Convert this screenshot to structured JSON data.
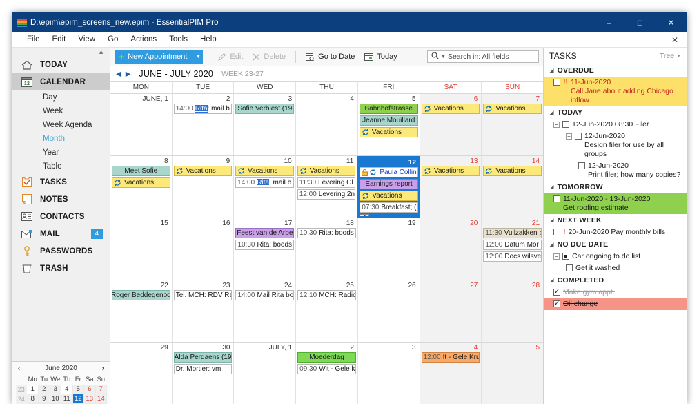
{
  "window": {
    "title": "D:\\epim\\epim_screens_new.epim - EssentialPIM Pro",
    "app_icon": "epim-logo-icon",
    "minimize": "–",
    "maximize": "□",
    "close": "✕"
  },
  "menu": {
    "items": [
      "File",
      "Edit",
      "View",
      "Go",
      "Actions",
      "Tools",
      "Help"
    ],
    "close_doc": "✕"
  },
  "sidebar": {
    "items": [
      {
        "label": "TODAY",
        "icon": "home-icon",
        "selected": false
      },
      {
        "label": "CALENDAR",
        "icon": "calendar-icon",
        "selected": true
      },
      {
        "label": "TASKS",
        "icon": "clipboard-check-icon",
        "selected": false
      },
      {
        "label": "NOTES",
        "icon": "note-icon",
        "selected": false
      },
      {
        "label": "CONTACTS",
        "icon": "contact-card-icon",
        "selected": false
      },
      {
        "label": "MAIL",
        "icon": "envelope-icon",
        "selected": false,
        "badge": "4"
      },
      {
        "label": "PASSWORDS",
        "icon": "key-icon",
        "selected": false
      },
      {
        "label": "TRASH",
        "icon": "trash-icon",
        "selected": false
      }
    ],
    "calendar_subitems": [
      {
        "label": "Day",
        "active": false
      },
      {
        "label": "Week",
        "active": false
      },
      {
        "label": "Week Agenda",
        "active": false
      },
      {
        "label": "Month",
        "active": true
      },
      {
        "label": "Year",
        "active": false
      },
      {
        "label": "Table",
        "active": false
      }
    ]
  },
  "minicalendar": {
    "prev": "‹",
    "next": "›",
    "title": "June 2020",
    "weekday_headers": [
      "Mo",
      "Tu",
      "We",
      "Th",
      "Fr",
      "Sa",
      "Su"
    ],
    "rows": [
      {
        "week": "23",
        "days": [
          "1",
          "2",
          "3",
          "4",
          "5",
          "6",
          "7"
        ]
      },
      {
        "week": "24",
        "days": [
          "8",
          "9",
          "10",
          "11",
          "12",
          "13",
          "14"
        ]
      }
    ],
    "selected_day": "12"
  },
  "toolbar": {
    "new_appointment": "New Appointment",
    "new_appointment_plus": "+",
    "dropdown_caret": "▼",
    "edit": "Edit",
    "delete": "Delete",
    "go_to_date": "Go to Date",
    "today": "Today",
    "search_placeholder": "Search in: All fields"
  },
  "calendar": {
    "prev_arrow": "◀",
    "next_arrow": "▶",
    "title": "JUNE - JULY 2020",
    "week_range": "WEEK 23-27",
    "weekdays": [
      "MON",
      "TUE",
      "WED",
      "THU",
      "FRI",
      "SAT",
      "SUN"
    ],
    "weeks": [
      {
        "days": [
          {
            "num": "JUNE, 1",
            "events": []
          },
          {
            "num": "2",
            "events": [
              {
                "time": "14:00",
                "text": "Rita: mail b",
                "style": "plain",
                "highlight": "Rita"
              }
            ]
          },
          {
            "num": "3",
            "events": [
              {
                "text": "Sofie Verbiest (19",
                "style": "teal"
              }
            ]
          },
          {
            "num": "4",
            "events": []
          },
          {
            "num": "5",
            "events": [
              {
                "text": "Bahnhofstrasse",
                "style": "greenband"
              },
              {
                "text": "Jeanne Mouillard",
                "style": "teal"
              },
              {
                "text": "Vacations",
                "style": "yellow",
                "recurring": true
              }
            ]
          },
          {
            "num": "6",
            "weekend": true,
            "events": [
              {
                "text": "Vacations",
                "style": "yellow",
                "recurring": true
              }
            ]
          },
          {
            "num": "7",
            "weekend": true,
            "events": [
              {
                "text": "Vacations",
                "style": "yellow",
                "recurring": true
              }
            ]
          }
        ]
      },
      {
        "days": [
          {
            "num": "8",
            "events": [
              {
                "text": "Meet Sofie",
                "style": "teal"
              },
              {
                "text": "Vacations",
                "style": "yellow",
                "recurring": true
              }
            ]
          },
          {
            "num": "9",
            "events": [
              {
                "text": "Vacations",
                "style": "yellow",
                "recurring": true
              }
            ]
          },
          {
            "num": "10",
            "events": [
              {
                "text": "Vacations",
                "style": "yellow",
                "recurring": true
              },
              {
                "time": "14:00",
                "text": "Rita: mail b",
                "style": "plain",
                "highlight": "Rita"
              }
            ]
          },
          {
            "num": "11",
            "events": [
              {
                "text": "Vacations",
                "style": "yellow",
                "recurring": true
              },
              {
                "time": "11:30",
                "text": "Levering Cl",
                "style": "plain"
              },
              {
                "time": "12:00",
                "text": "Levering 2n",
                "style": "plain"
              }
            ]
          },
          {
            "num": "12",
            "selected": true,
            "events": [
              {
                "text": "Paula Collins",
                "style": "plain",
                "recurring": true,
                "locked": true,
                "link": true
              },
              {
                "text": "Earnings report",
                "style": "purple"
              },
              {
                "text": "Vacations",
                "style": "yellow",
                "recurring": true
              },
              {
                "time": "07:30",
                "text": "Breakfast; (",
                "style": "plain"
              }
            ],
            "more_button": true
          },
          {
            "num": "13",
            "weekend": true,
            "events": [
              {
                "text": "Vacations",
                "style": "yellow",
                "recurring": true
              }
            ]
          },
          {
            "num": "14",
            "weekend": true,
            "events": [
              {
                "text": "Vacations",
                "style": "yellow",
                "recurring": true
              }
            ]
          }
        ]
      },
      {
        "days": [
          {
            "num": "15",
            "events": []
          },
          {
            "num": "16",
            "events": []
          },
          {
            "num": "17",
            "events": [
              {
                "text": "Feest van de Arbe",
                "style": "purple"
              },
              {
                "time": "10:30",
                "text": "Rita: boods",
                "style": "plain"
              }
            ]
          },
          {
            "num": "18",
            "events": [
              {
                "time": "10:30",
                "text": "Rita: boods",
                "style": "plain"
              }
            ]
          },
          {
            "num": "19",
            "events": []
          },
          {
            "num": "20",
            "weekend": true,
            "events": []
          },
          {
            "num": "21",
            "weekend": true,
            "events": [
              {
                "time": "11:30",
                "text": "Vuilzakken b",
                "style": "tan"
              },
              {
                "time": "12:00",
                "text": "Datum Mor",
                "style": "plain"
              },
              {
                "time": "12:00",
                "text": "Docs wilsve",
                "style": "plain"
              }
            ]
          }
        ]
      },
      {
        "days": [
          {
            "num": "22",
            "events": [
              {
                "text": "Roger Beddegenod",
                "style": "teal"
              }
            ]
          },
          {
            "num": "23",
            "events": [
              {
                "text": "Tel. MCH: RDV Ra",
                "style": "plain"
              }
            ]
          },
          {
            "num": "24",
            "events": [
              {
                "time": "14:00",
                "text": "Mail Rita bo",
                "style": "plain"
              }
            ]
          },
          {
            "num": "25",
            "events": [
              {
                "time": "12:10",
                "text": "MCH: Radio",
                "style": "plain"
              }
            ]
          },
          {
            "num": "26",
            "events": []
          },
          {
            "num": "27",
            "weekend": true,
            "events": []
          },
          {
            "num": "28",
            "weekend": true,
            "events": []
          }
        ]
      },
      {
        "days": [
          {
            "num": "29",
            "events": []
          },
          {
            "num": "30",
            "events": [
              {
                "text": "Alda Perdaens (19",
                "style": "teal"
              },
              {
                "text": "Dr. Mortier: vm",
                "style": "plain"
              }
            ]
          },
          {
            "num": "JULY, 1",
            "greyed": true,
            "events": []
          },
          {
            "num": "2",
            "greyed": true,
            "events": [
              {
                "text": "Moederdag",
                "style": "green"
              },
              {
                "time": "09:30",
                "text": "Wit - Gele k",
                "style": "plain"
              }
            ]
          },
          {
            "num": "3",
            "greyed": true,
            "events": []
          },
          {
            "num": "4",
            "weekend": true,
            "greyed": true,
            "events": [
              {
                "time": "12:00",
                "text": "It - Gele Kru",
                "style": "orange"
              }
            ]
          },
          {
            "num": "5",
            "weekend": true,
            "greyed": true,
            "events": []
          }
        ]
      }
    ]
  },
  "tasks": {
    "title": "TASKS",
    "mode": "Tree",
    "mode_caret": "▼",
    "groups": [
      {
        "name": "OVERDUE",
        "items": [
          {
            "indent": 0,
            "checkbox": "empty",
            "priority": "!!",
            "date": "11-Jun-2020",
            "text": "Call Jane about adding Chicago inflow",
            "highlight": "yellow",
            "red_text": true
          }
        ]
      },
      {
        "name": "TODAY",
        "items": [
          {
            "indent": 0,
            "checkbox": "empty",
            "expander": "−",
            "date": "12-Jun-2020 08:30",
            "text": "Filer",
            "inline": true
          },
          {
            "indent": 1,
            "checkbox": "empty",
            "expander": "−",
            "date": "12-Jun-2020",
            "text": "Design filer for use by all groups"
          },
          {
            "indent": 2,
            "checkbox": "empty",
            "date": "12-Jun-2020",
            "text": "Print filer; how many copies?"
          }
        ]
      },
      {
        "name": "TOMORROW",
        "items": [
          {
            "indent": 0,
            "checkbox": "empty",
            "date": "11-Jun-2020 - 13-Jun-2020",
            "text": "Get roofing estimate",
            "highlight": "green"
          }
        ]
      },
      {
        "name": "NEXT WEEK",
        "items": [
          {
            "indent": 0,
            "checkbox": "empty",
            "priority": "!",
            "date": "20-Jun-2020",
            "text": "Pay monthly bills",
            "inline": true
          }
        ]
      },
      {
        "name": "NO DUE DATE",
        "items": [
          {
            "indent": 0,
            "checkbox": "partial",
            "expander": "−",
            "text": "Car ongoing to do list",
            "inline": true
          },
          {
            "indent": 1,
            "checkbox": "empty",
            "text": "Get it washed",
            "inline": true
          }
        ]
      },
      {
        "name": "COMPLETED",
        "items": [
          {
            "indent": 0,
            "checkbox": "checked",
            "text": "Make gym appt.",
            "inline": true,
            "completed": true,
            "grey": true
          },
          {
            "indent": 0,
            "checkbox": "checked",
            "text": "Oil change",
            "inline": true,
            "completed": true,
            "highlight": "red"
          }
        ]
      }
    ]
  }
}
